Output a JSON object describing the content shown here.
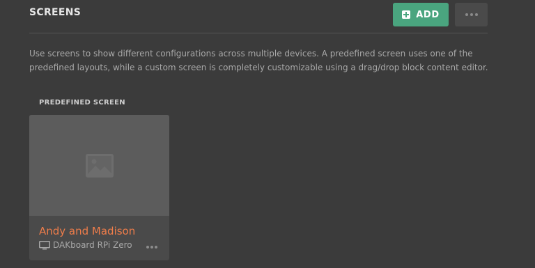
{
  "header": {
    "title": "SCREENS",
    "add_label": "ADD",
    "add_icon": "plus-square-icon",
    "more_icon": "ellipsis-icon"
  },
  "description": "Use screens to show different configurations across multiple devices. A predefined screen uses one of the predefined layouts, while a custom screen is completely customizable using a drag/drop block content editor.",
  "section": {
    "label": "PREDEFINED SCREEN"
  },
  "screens": [
    {
      "name": "Andy and Madison",
      "device": "DAKboard RPi Zero",
      "thumbnail_icon": "image-placeholder-icon",
      "device_icon": "monitor-icon",
      "more_icon": "ellipsis-icon"
    }
  ],
  "colors": {
    "background": "#3b3b3b",
    "accent_green": "#4aa57f",
    "accent_orange": "#ef7d4a",
    "card": "#4a4a4a"
  }
}
